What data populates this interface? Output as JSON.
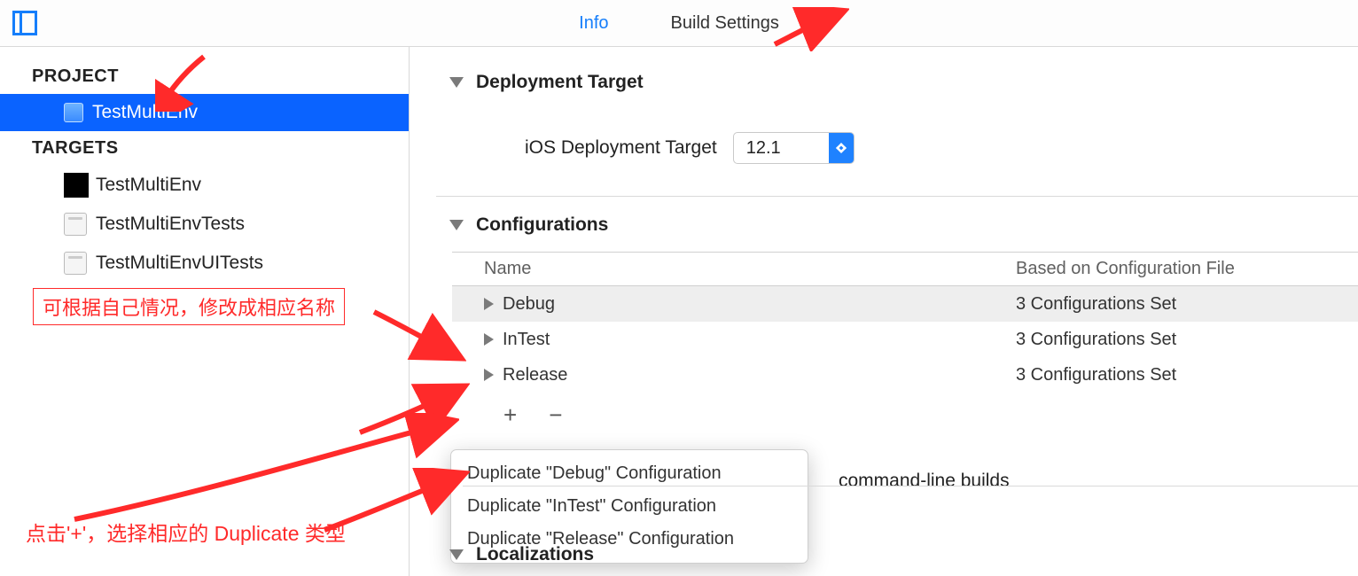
{
  "tabs": {
    "info": "Info",
    "build": "Build Settings"
  },
  "sidebar": {
    "project_header": "PROJECT",
    "project_name": "TestMultiEnv",
    "targets_header": "TARGETS",
    "targets": [
      "TestMultiEnv",
      "TestMultiEnvTests",
      "TestMultiEnvUITests"
    ]
  },
  "deployment": {
    "section": "Deployment Target",
    "label": "iOS Deployment Target",
    "value": "12.1"
  },
  "configurations": {
    "section": "Configurations",
    "name_header": "Name",
    "based_header": "Based on Configuration File",
    "rows": [
      {
        "name": "Debug",
        "based": "3 Configurations Set"
      },
      {
        "name": "InTest",
        "based": "3 Configurations Set"
      },
      {
        "name": "Release",
        "based": "3 Configurations Set"
      }
    ],
    "plus": "+",
    "minus": "−",
    "cmdline_suffix": "command-line builds"
  },
  "menu": {
    "items": [
      "Duplicate \"Debug\" Configuration",
      "Duplicate \"InTest\" Configuration",
      "Duplicate \"Release\" Configuration"
    ]
  },
  "localizations": {
    "section": "Localizations"
  },
  "annotations": {
    "rename": "可根据自己情况，修改成相应名称",
    "plus_hint": "点击'+'，选择相应的 Duplicate 类型"
  }
}
